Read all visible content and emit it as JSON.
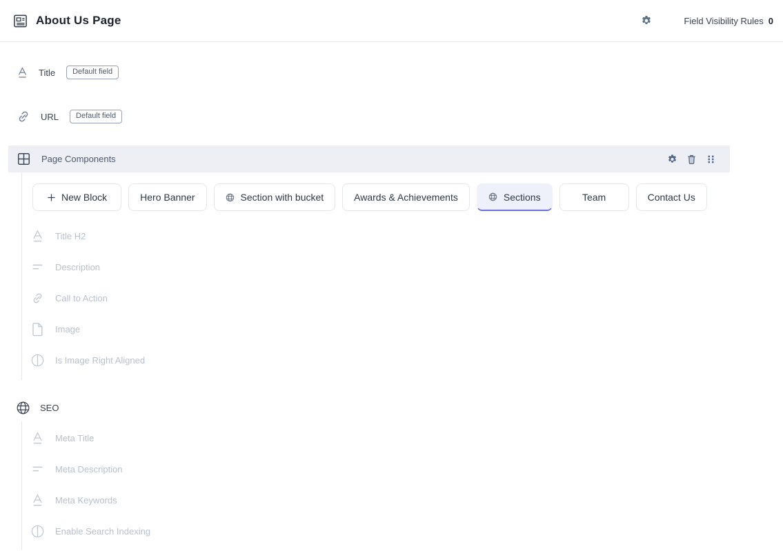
{
  "header": {
    "title": "About Us Page",
    "field_visibility_rules_label": "Field Visibility Rules",
    "field_visibility_rules_count": "0"
  },
  "fields": {
    "title": {
      "label": "Title",
      "badge": "Default field",
      "icon": "text-icon"
    },
    "url": {
      "label": "URL",
      "badge": "Default field",
      "icon": "link-icon"
    }
  },
  "page_components": {
    "label": "Page Components",
    "actions": [
      "settings-icon",
      "trash-icon",
      "drag-handle-icon"
    ],
    "new_block_label": "New Block",
    "blocks": [
      {
        "label": "Hero Banner",
        "localized": false,
        "selected": false
      },
      {
        "label": "Section with bucket",
        "localized": true,
        "selected": false
      },
      {
        "label": "Awards & Achievements",
        "localized": false,
        "selected": false
      },
      {
        "label": "Sections",
        "localized": true,
        "selected": true
      },
      {
        "label": "Team",
        "localized": false,
        "selected": false
      },
      {
        "label": "Contact Us",
        "localized": false,
        "selected": false
      }
    ],
    "selected_block_fields": [
      {
        "label": "Title H2",
        "icon": "text"
      },
      {
        "label": "Description",
        "icon": "multiline"
      },
      {
        "label": "Call to Action",
        "icon": "link"
      },
      {
        "label": "Image",
        "icon": "file"
      },
      {
        "label": "Is Image Right Aligned",
        "icon": "boolean"
      }
    ]
  },
  "seo": {
    "label": "SEO",
    "icon": "globe-icon",
    "fields": [
      {
        "label": "Meta Title",
        "icon": "text"
      },
      {
        "label": "Meta Description",
        "icon": "multiline"
      },
      {
        "label": "Meta Keywords",
        "icon": "text"
      },
      {
        "label": "Enable Search Indexing",
        "icon": "boolean"
      }
    ]
  },
  "colors": {
    "accent_purple": "#6a6fe2",
    "selected_tab_bg": "#eef0fa",
    "group_bar_bg": "#edeff5",
    "muted_text": "#b9c1ce",
    "slate_icon": "#51678a"
  }
}
